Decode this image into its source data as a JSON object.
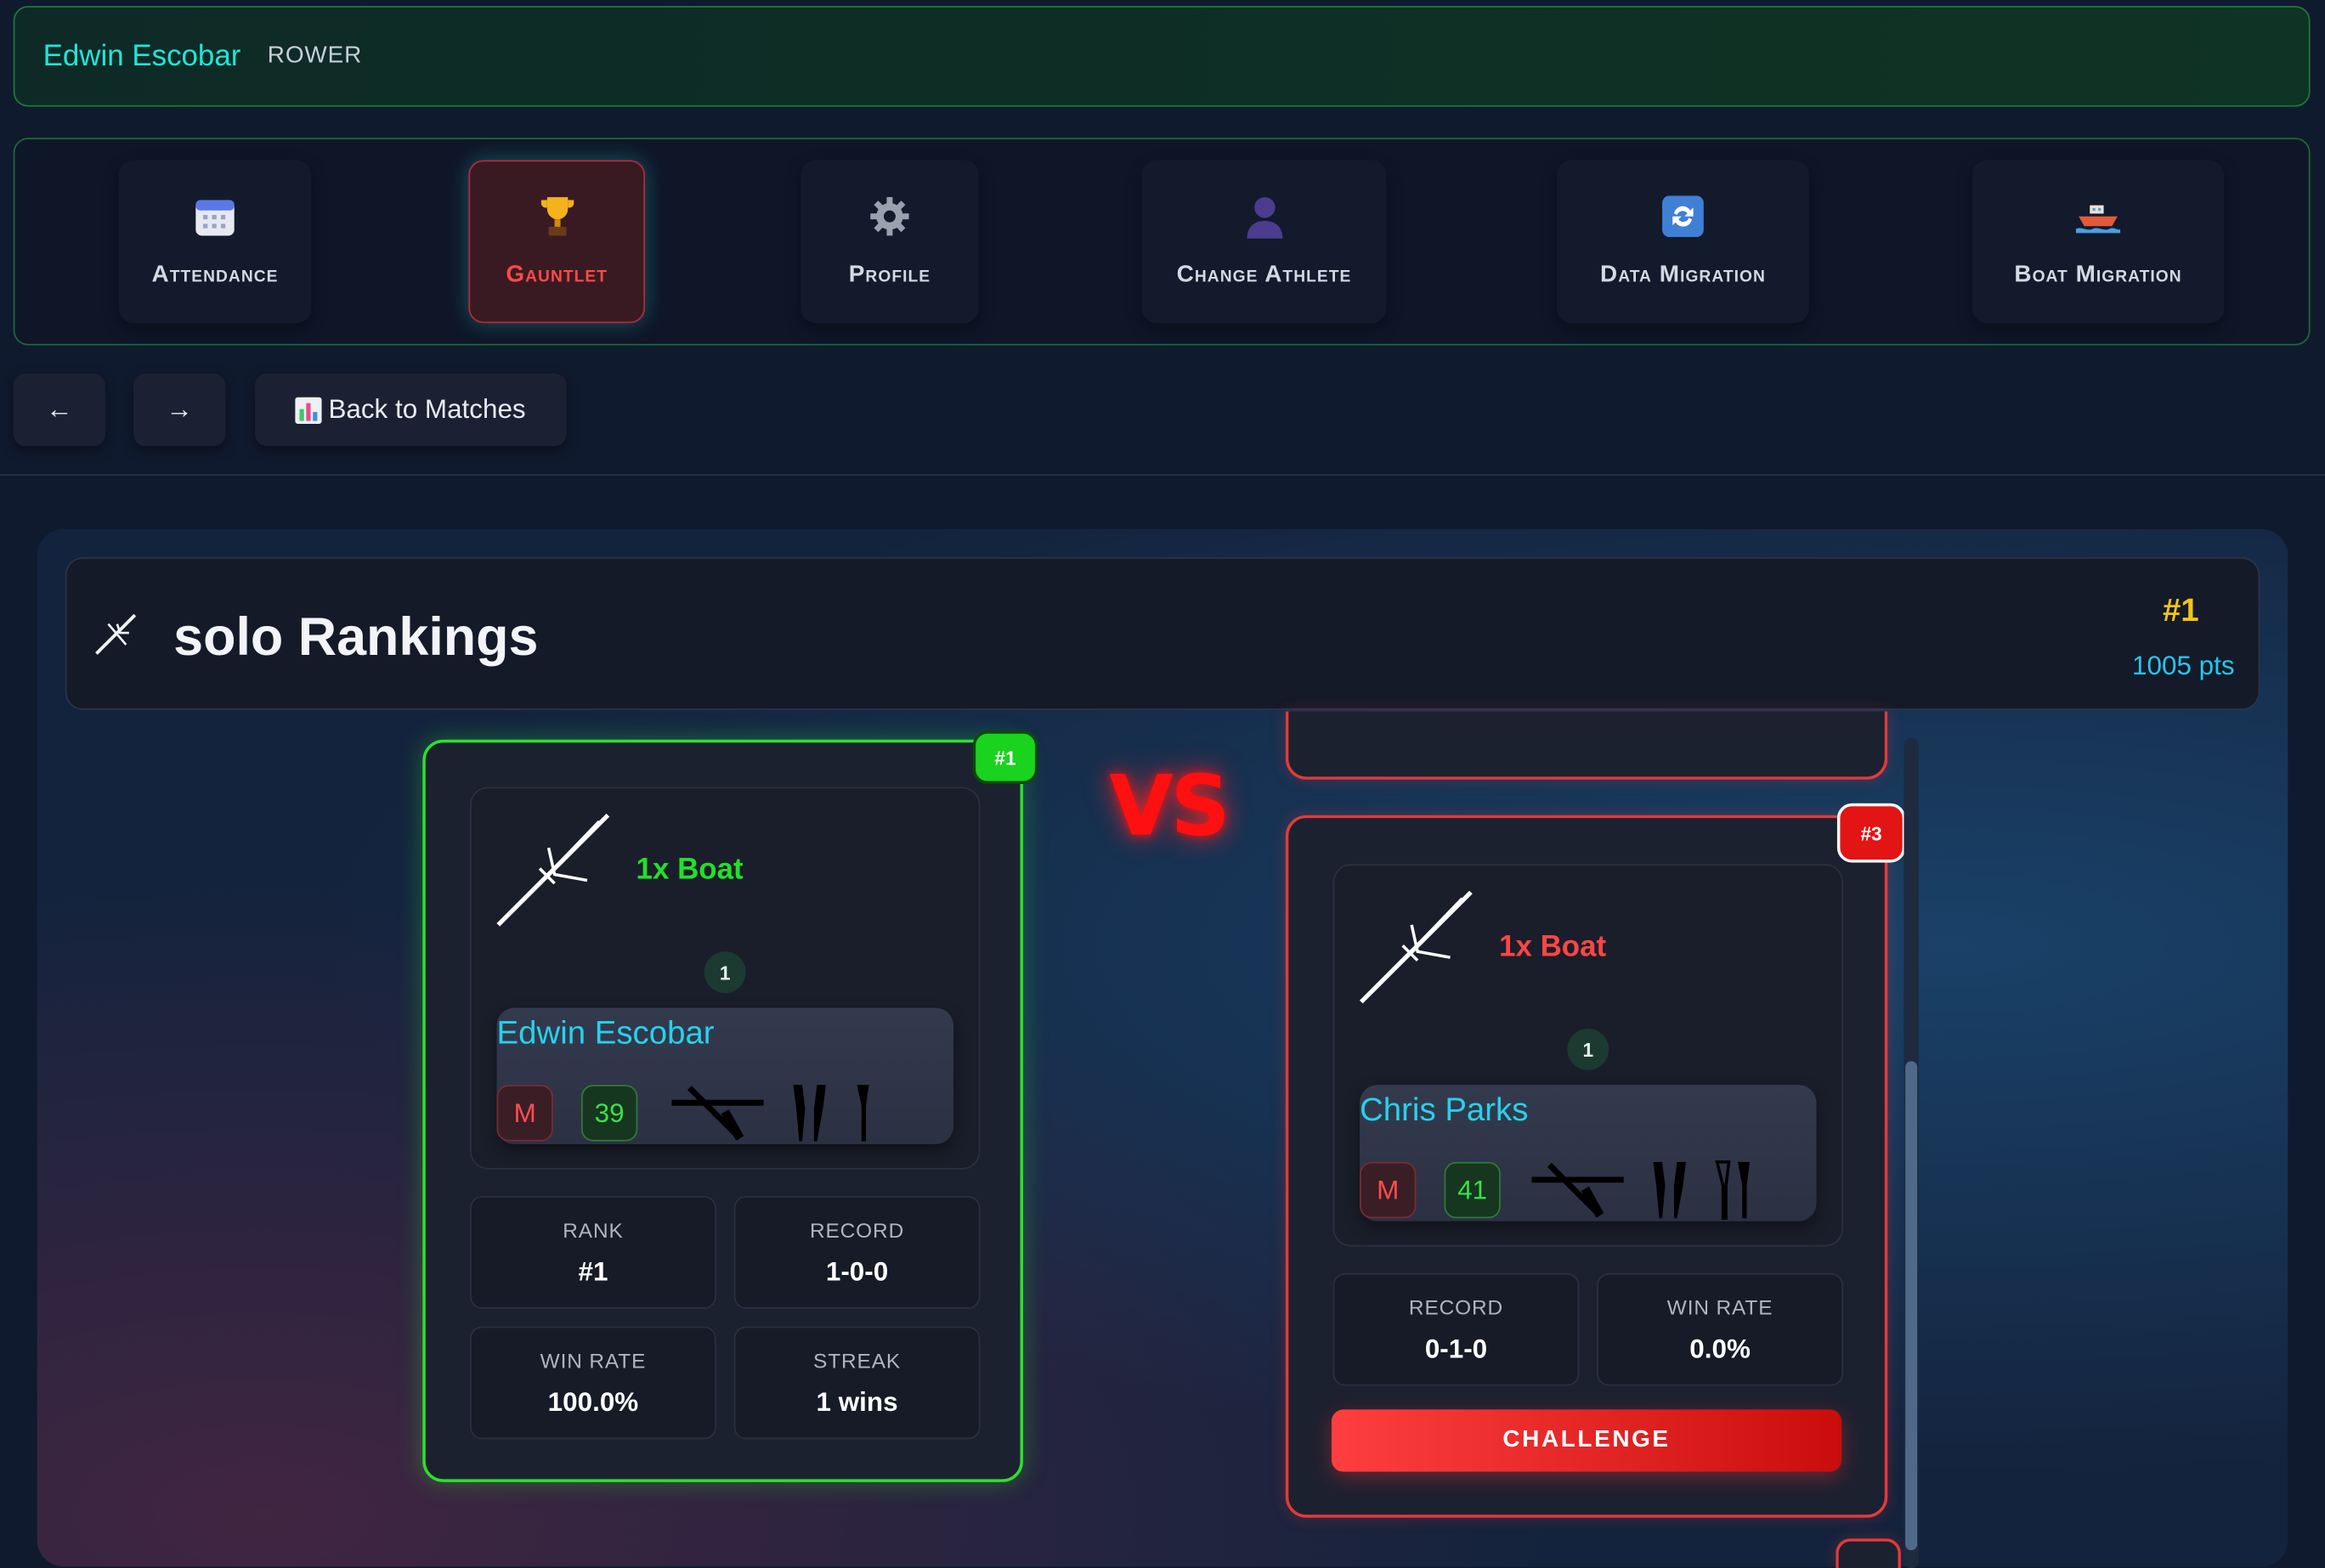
{
  "header": {
    "user_name": "Edwin Escobar",
    "role": "ROWER"
  },
  "nav": {
    "items": [
      {
        "label": "Attendance",
        "icon": "calendar-icon"
      },
      {
        "label": "Gauntlet",
        "icon": "trophy-icon",
        "active": true
      },
      {
        "label": "Profile",
        "icon": "gear-icon"
      },
      {
        "label": "Change Athlete",
        "icon": "person-icon"
      },
      {
        "label": "Data Migration",
        "icon": "sync-icon"
      },
      {
        "label": "Boat Migration",
        "icon": "boat-icon"
      }
    ]
  },
  "controls": {
    "back_arrow": "←",
    "forward_arrow": "→",
    "back_to_matches": "Back to Matches"
  },
  "rankings": {
    "title": "solo Rankings",
    "rank": "#1",
    "points": "1005 pts"
  },
  "vs_label": "VS",
  "my_card": {
    "rank_badge": "#1",
    "boat_label": "1x Boat",
    "seat": "1",
    "athlete_name": "Edwin Escobar",
    "gender": "M",
    "number": "39",
    "stats": [
      {
        "label": "RANK",
        "value": "#1"
      },
      {
        "label": "RECORD",
        "value": "1-0-0"
      },
      {
        "label": "WIN RATE",
        "value": "100.0%"
      },
      {
        "label": "STREAK",
        "value": "1 wins"
      }
    ]
  },
  "opponent_card": {
    "rank_badge": "#3",
    "boat_label": "1x Boat",
    "seat": "1",
    "athlete_name": "Chris Parks",
    "gender": "M",
    "number": "41",
    "stats": [
      {
        "label": "RECORD",
        "value": "0-1-0"
      },
      {
        "label": "WIN RATE",
        "value": "0.0%"
      }
    ],
    "challenge_label": "CHALLENGE"
  },
  "colors": {
    "accent_green": "#2ee02e",
    "accent_red": "#e23a3a",
    "accent_cyan": "#26d2ec",
    "gold": "#f3c316"
  }
}
